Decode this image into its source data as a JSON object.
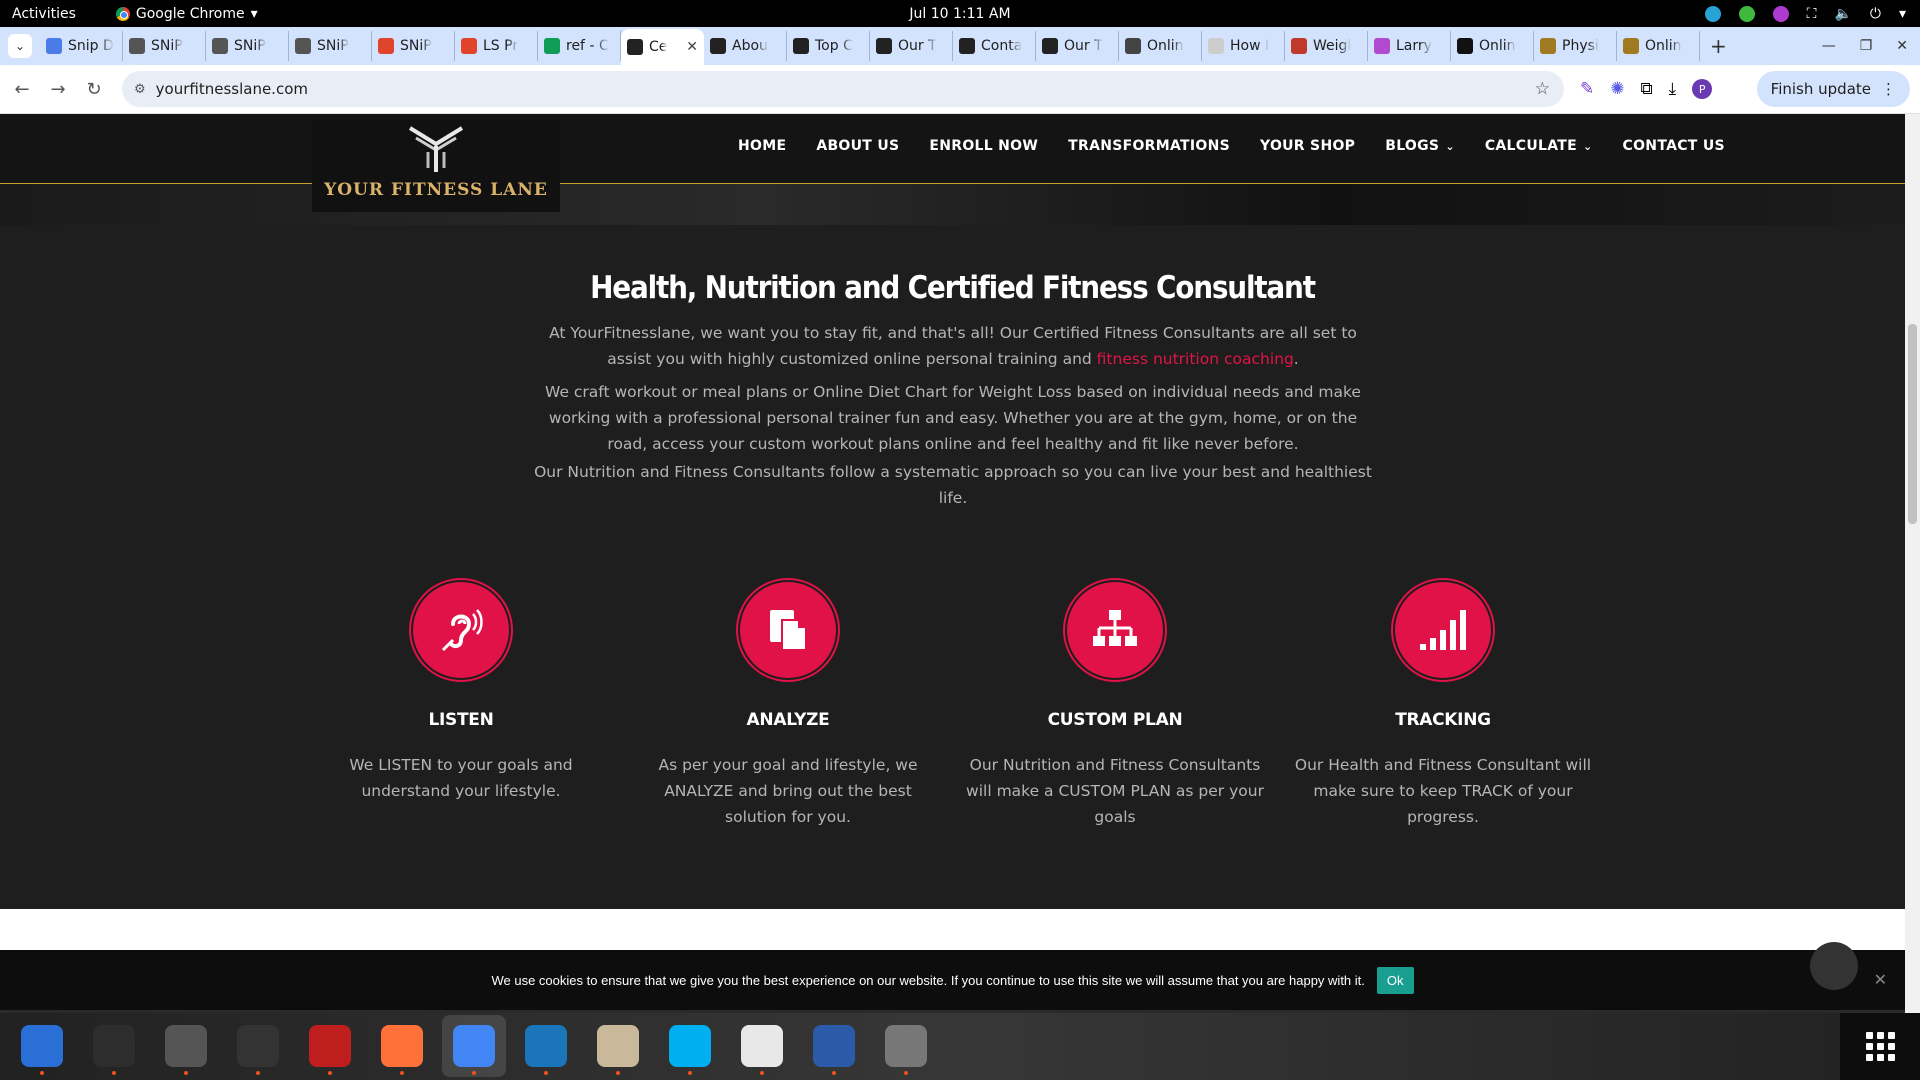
{
  "system": {
    "activities": "Activities",
    "app_name": "Google Chrome",
    "clock": "Jul 10  1:11 AM"
  },
  "tabs": [
    {
      "title": "Snip D",
      "favicon_color": "#4a7be8"
    },
    {
      "title": "SNiP",
      "favicon_color": "#555555"
    },
    {
      "title": "SNiP",
      "favicon_color": "#555555"
    },
    {
      "title": "SNiP",
      "favicon_color": "#555555"
    },
    {
      "title": "SNiP",
      "favicon_color": "#e0442a"
    },
    {
      "title": "LS Pr",
      "favicon_color": "#e0442a"
    },
    {
      "title": "ref - C",
      "favicon_color": "#0f9d58"
    },
    {
      "title": "Ce",
      "favicon_color": "#222222",
      "active": true
    },
    {
      "title": "Abou",
      "favicon_color": "#222222"
    },
    {
      "title": "Top C",
      "favicon_color": "#222222"
    },
    {
      "title": "Our T",
      "favicon_color": "#222222"
    },
    {
      "title": "Conta",
      "favicon_color": "#222222"
    },
    {
      "title": "Our T",
      "favicon_color": "#222222"
    },
    {
      "title": "Onlin",
      "favicon_color": "#444444"
    },
    {
      "title": "How I",
      "favicon_color": "#cccccc"
    },
    {
      "title": "Weigl",
      "favicon_color": "#c0392b"
    },
    {
      "title": "Larry",
      "favicon_color": "#b04ad0"
    },
    {
      "title": "Onlin",
      "favicon_color": "#111111"
    },
    {
      "title": "Physi",
      "favicon_color": "#a07a20"
    },
    {
      "title": "Onlin",
      "favicon_color": "#a07a20"
    }
  ],
  "omnibox": {
    "url": "yourfitnesslane.com",
    "finish_update": "Finish update",
    "profile_initial": "P"
  },
  "site": {
    "logo_text": "YOUR FITNESS LANE",
    "nav": [
      {
        "label": "HOME"
      },
      {
        "label": "ABOUT US"
      },
      {
        "label": "ENROLL NOW"
      },
      {
        "label": "TRANSFORMATIONS"
      },
      {
        "label": "YOUR SHOP"
      },
      {
        "label": "BLOGS",
        "dropdown": true
      },
      {
        "label": "CALCULATE",
        "dropdown": true
      },
      {
        "label": "CONTACT US"
      }
    ],
    "heading": "Health, Nutrition and Certified Fitness Consultant",
    "para1_before": "At YourFitnesslane, we want you to stay fit, and that's all! Our Certified Fitness Consultants are all set to assist you with highly customized online personal training and ",
    "para1_link": "fitness nutrition coaching",
    "para1_after": ".",
    "para2": "We craft workout or meal plans or Online Diet Chart for Weight Loss based on individual needs and make working with a professional personal trainer fun and easy. Whether you are at the gym, home, or on the road, access your custom workout plans online and feel healthy and fit like never before.",
    "para3": "Our Nutrition and Fitness Consultants follow a systematic approach so you can live your best and healthiest life.",
    "features": [
      {
        "icon": "listen-ear-icon",
        "title": "LISTEN",
        "desc": "We LISTEN to your goals and understand your lifestyle."
      },
      {
        "icon": "document-copy-icon",
        "title": "ANALYZE",
        "desc": "As per your goal and lifestyle, we ANALYZE and bring out the best solution for you."
      },
      {
        "icon": "sitemap-icon",
        "title": "CUSTOM PLAN",
        "desc": "Our Nutrition and Fitness Consultants will make a CUSTOM PLAN as per your goals"
      },
      {
        "icon": "signal-bars-icon",
        "title": "TRACKING",
        "desc": "Our Health and Fitness Consultant will make sure to keep TRACK of your progress."
      }
    ],
    "accent_color": "#e01247",
    "cookie_text": "We use cookies to ensure that we give you the best experience on our website. If you continue to use this site we will assume that you are happy with it.",
    "cookie_ok": "Ok"
  },
  "dock": [
    {
      "name": "thunderbird",
      "color": "#2a6fd6"
    },
    {
      "name": "terminal",
      "color": "#2d2d2d"
    },
    {
      "name": "calculator",
      "color": "#555555"
    },
    {
      "name": "system-monitor",
      "color": "#333333"
    },
    {
      "name": "filezilla",
      "color": "#bf1e1e"
    },
    {
      "name": "firefox",
      "color": "#ff7139"
    },
    {
      "name": "chrome",
      "color": "#4285f4"
    },
    {
      "name": "vscode",
      "color": "#1b75bb"
    },
    {
      "name": "files",
      "color": "#c9b99a"
    },
    {
      "name": "skype",
      "color": "#00aff0"
    },
    {
      "name": "text-editor",
      "color": "#e8e8e8"
    },
    {
      "name": "libreoffice-writer",
      "color": "#2b5ba8"
    },
    {
      "name": "disk-utility",
      "color": "#777777"
    }
  ]
}
